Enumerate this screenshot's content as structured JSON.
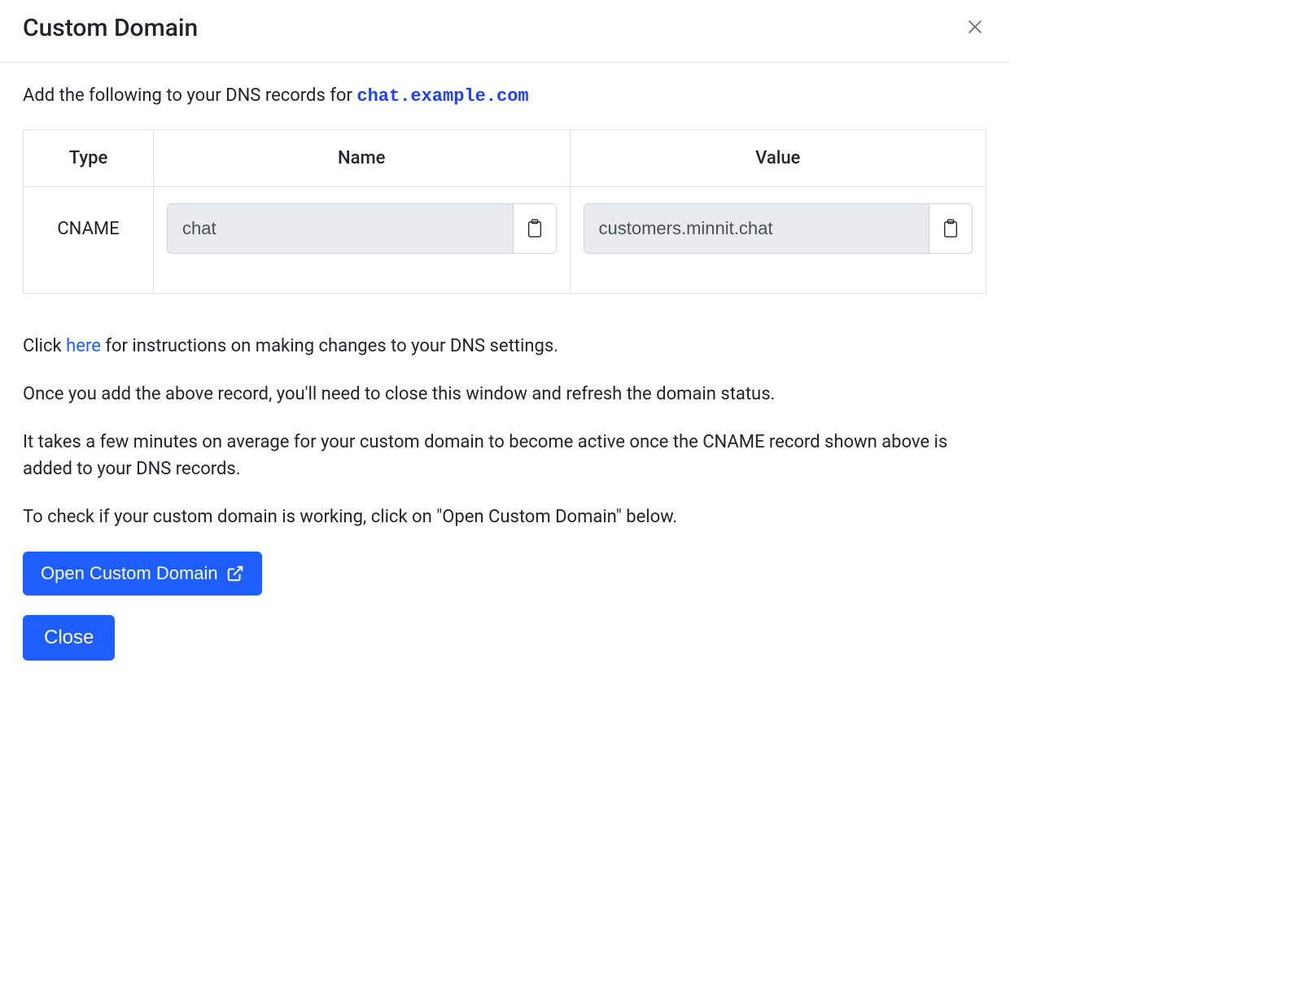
{
  "modal": {
    "title": "Custom Domain",
    "intro_prefix": "Add the following to your DNS records for ",
    "domain": "chat.example.com",
    "table": {
      "headers": {
        "type": "Type",
        "name": "Name",
        "value": "Value"
      },
      "row": {
        "type": "CNAME",
        "name_value": "chat",
        "value_value": "customers.minnit.chat"
      }
    },
    "instructions": {
      "click_prefix": "Click ",
      "here_link": "here",
      "click_suffix": " for instructions on making changes to your DNS settings.",
      "refresh_text": "Once you add the above record, you'll need to close this window and refresh the domain status.",
      "wait_text": "It takes a few minutes on average for your custom domain to become active once the CNAME record shown above is added to your DNS records.",
      "check_text": "To check if your custom domain is working, click on \"Open Custom Domain\" below."
    },
    "buttons": {
      "open_domain": "Open Custom Domain",
      "close": "Close"
    }
  }
}
